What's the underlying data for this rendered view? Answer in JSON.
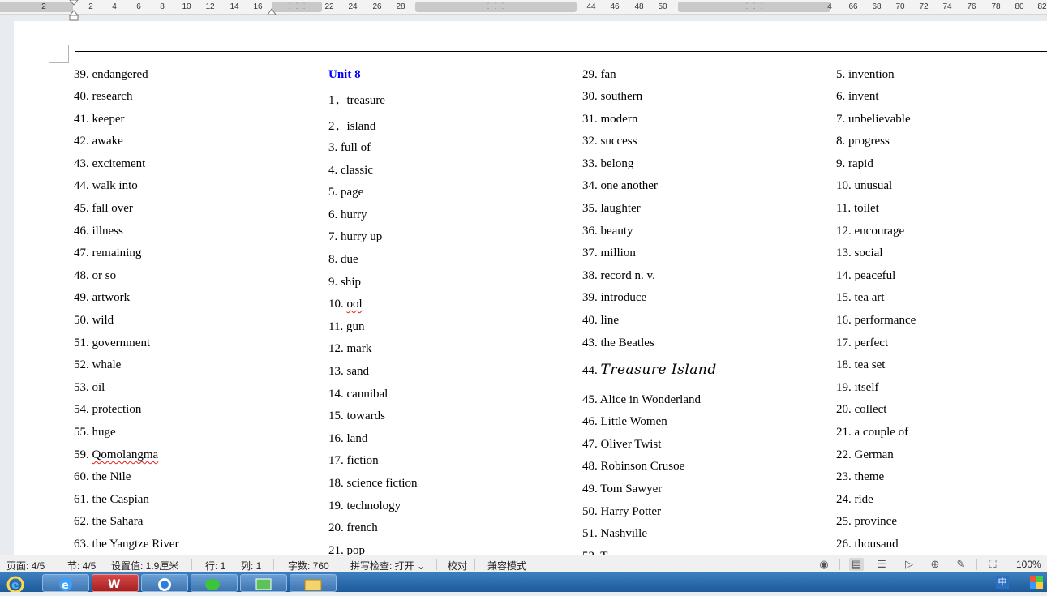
{
  "ruler": {
    "ticks": [
      "2",
      "2",
      "4",
      "6",
      "8",
      "10",
      "12",
      "14",
      "16",
      "22",
      "24",
      "26",
      "28",
      "44",
      "46",
      "48",
      "50",
      "4",
      "66",
      "68",
      "70",
      "72",
      "74",
      "76",
      "78",
      "80",
      "82"
    ]
  },
  "columns": [
    {
      "items": [
        {
          "text": "39. endangered"
        },
        {
          "text": "40. research"
        },
        {
          "text": "41. keeper"
        },
        {
          "text": "42. awake"
        },
        {
          "text": "43. excitement"
        },
        {
          "text": "44. walk into"
        },
        {
          "text": "45. fall over"
        },
        {
          "text": "46. illness"
        },
        {
          "text": "47. remaining"
        },
        {
          "text": "48. or so"
        },
        {
          "text": "49. artwork"
        },
        {
          "text": "50. wild"
        },
        {
          "text": "51. government"
        },
        {
          "text": "52. whale"
        },
        {
          "text": "53. oil"
        },
        {
          "text": "54. protection"
        },
        {
          "text": "55. huge"
        },
        {
          "text": "59. ",
          "squig": "Qomolangma"
        },
        {
          "text": "60. the Nile"
        },
        {
          "text": "61. the Caspian"
        },
        {
          "text": "62. the Sahara"
        },
        {
          "text": "63. the Yangtze River"
        }
      ]
    },
    {
      "items": [
        {
          "text": "Unit 8",
          "style": "unit"
        },
        {
          "text": "1．treasure"
        },
        {
          "text": "2．island"
        },
        {
          "text": "3. full of"
        },
        {
          "text": "4. classic"
        },
        {
          "text": "5. page"
        },
        {
          "text": "6. hurry"
        },
        {
          "text": "7. hurry up"
        },
        {
          "text": "8. due"
        },
        {
          "text": "9. ship"
        },
        {
          "text": "10. ",
          "squig": "ool"
        },
        {
          "text": "11. gun"
        },
        {
          "text": "12. mark"
        },
        {
          "text": "13. sand"
        },
        {
          "text": "14. cannibal"
        },
        {
          "text": "15. towards"
        },
        {
          "text": "16. land"
        },
        {
          "text": "17. fiction"
        },
        {
          "text": "18. science fiction"
        },
        {
          "text": "19. technology"
        },
        {
          "text": "20. french"
        },
        {
          "text": "21. pop"
        }
      ]
    },
    {
      "items": [
        {
          "text": "29. fan"
        },
        {
          "text": "30. southern"
        },
        {
          "text": "31. modern"
        },
        {
          "text": "32. success"
        },
        {
          "text": "33. belong"
        },
        {
          "text": "34. one another"
        },
        {
          "text": "35. laughter"
        },
        {
          "text": "36. beauty"
        },
        {
          "text": "37. million"
        },
        {
          "text": "38. record    n. v."
        },
        {
          "text": "39. introduce"
        },
        {
          "text": "40. line"
        },
        {
          "text": "43. the Beatles"
        },
        {
          "text": "44. ",
          "script": "Treasure Island"
        },
        {
          "text": "45. Alice in Wonderland"
        },
        {
          "text": "46. Little Women"
        },
        {
          "text": "47. Oliver Twist"
        },
        {
          "text": "48. Robinson Crusoe"
        },
        {
          "text": "49. Tom Sawyer"
        },
        {
          "text": "50. Harry Potter"
        },
        {
          "text": "51. Nashville"
        },
        {
          "text": "52. T"
        }
      ]
    },
    {
      "items": [
        {
          "text": "5. invention"
        },
        {
          "text": "6. invent"
        },
        {
          "text": "7. unbelievable"
        },
        {
          "text": "8. progress"
        },
        {
          "text": "9. rapid"
        },
        {
          "text": "10. unusual"
        },
        {
          "text": "11. toilet"
        },
        {
          "text": "12. encourage"
        },
        {
          "text": "13. social"
        },
        {
          "text": "14. peaceful"
        },
        {
          "text": "15. tea art"
        },
        {
          "text": "16. performance"
        },
        {
          "text": "17. perfect"
        },
        {
          "text": "18. tea set"
        },
        {
          "text": "19. itself"
        },
        {
          "text": "20. collect"
        },
        {
          "text": "21. a couple of"
        },
        {
          "text": "22. German"
        },
        {
          "text": "23. theme"
        },
        {
          "text": "24. ride"
        },
        {
          "text": "25. province"
        },
        {
          "text": "26. thousand"
        }
      ]
    }
  ],
  "status": {
    "page": "页面: 4/5",
    "section": "节: 4/5",
    "setting": "设置值: 1.9厘米",
    "row": "行: 1",
    "column": "列: 1",
    "words": "字数: 760",
    "spell": "拼写检查: 打开 ⌄",
    "proof": "校对",
    "compat": "兼容模式",
    "zoom": "100%"
  },
  "icons": {
    "eye": "eye-icon",
    "page_view": "page-view-icon",
    "outline": "outline-icon",
    "play": "play-icon",
    "web": "globe-icon",
    "pen": "pen-icon",
    "fit": "fit-page-icon"
  },
  "taskbar": {
    "apps": [
      "internet-explorer",
      "ie-browser",
      "wps",
      "qq-browser",
      "wechat",
      "green-app",
      "folder"
    ],
    "tray": "中"
  }
}
